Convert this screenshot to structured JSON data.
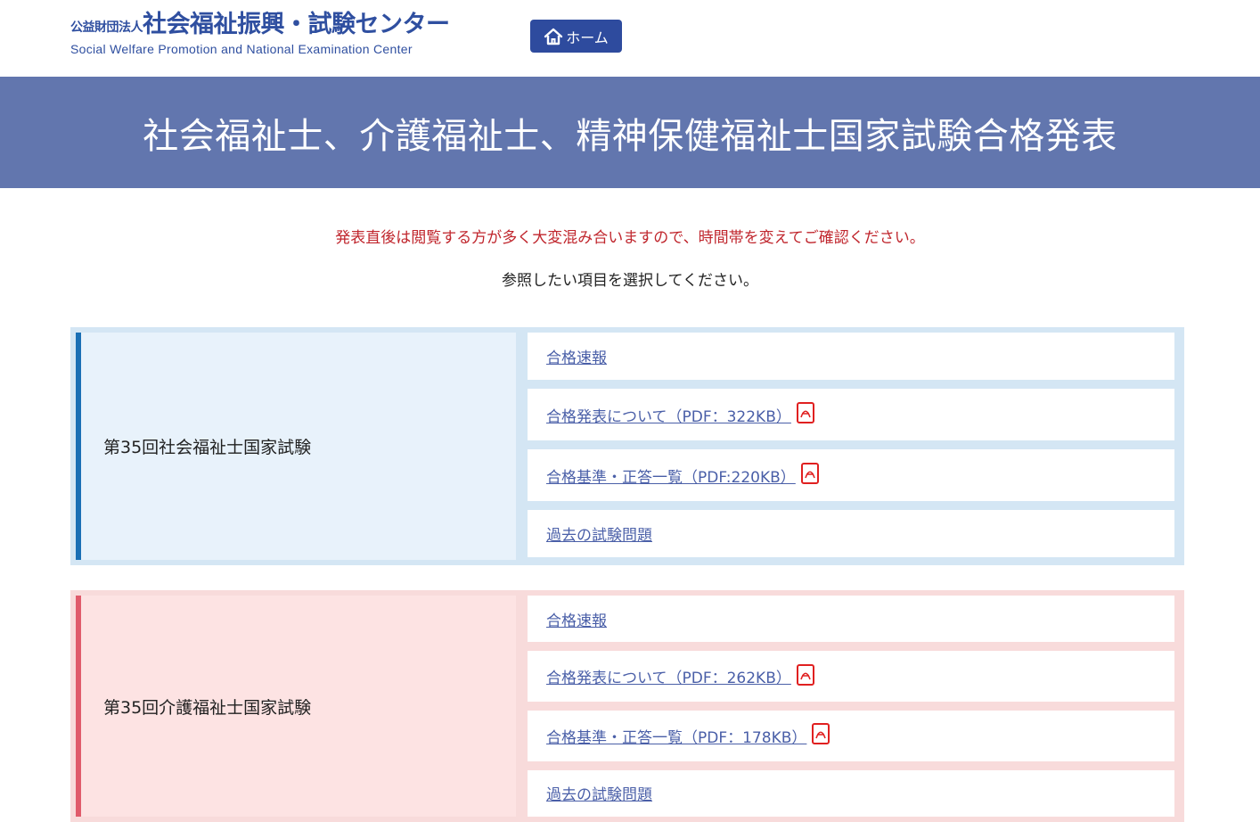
{
  "header": {
    "logo_small": "公益財団法人",
    "logo_main": "社会福祉振興・試験センター",
    "logo_en": "Social Welfare Promotion and National Examination Center",
    "home_label": "ホーム"
  },
  "banner": {
    "title": "社会福祉士、介護福祉士、精神保健福祉士国家試験合格発表"
  },
  "notice": "発表直後は閲覧する方が多く大変混み合いますので、時間帯を変えてご確認ください。",
  "instruct": "参照したい項目を選択してください。",
  "exams": [
    {
      "title": "第35回社会福祉士国家試験",
      "links": [
        {
          "label": "合格速報"
        },
        {
          "label": "合格発表について（PDF：322KB）",
          "pdf": true
        },
        {
          "label": "合格基準・正答一覧（PDF:220KB）",
          "pdf": true
        },
        {
          "label": "過去の試験問題"
        }
      ]
    },
    {
      "title": "第35回介護福祉士国家試験",
      "links": [
        {
          "label": "合格速報"
        },
        {
          "label": "合格発表について（PDF：262KB）",
          "pdf": true
        },
        {
          "label": "合格基準・正答一覧（PDF：178KB）",
          "pdf": true
        },
        {
          "label": "過去の試験問題"
        }
      ]
    }
  ],
  "colors": {
    "brand_blue": "#2e4b9e",
    "banner_bg": "#6276ae",
    "notice_red": "#c0262d",
    "link": "#4a5fa8",
    "pdf_red": "#e02020"
  }
}
